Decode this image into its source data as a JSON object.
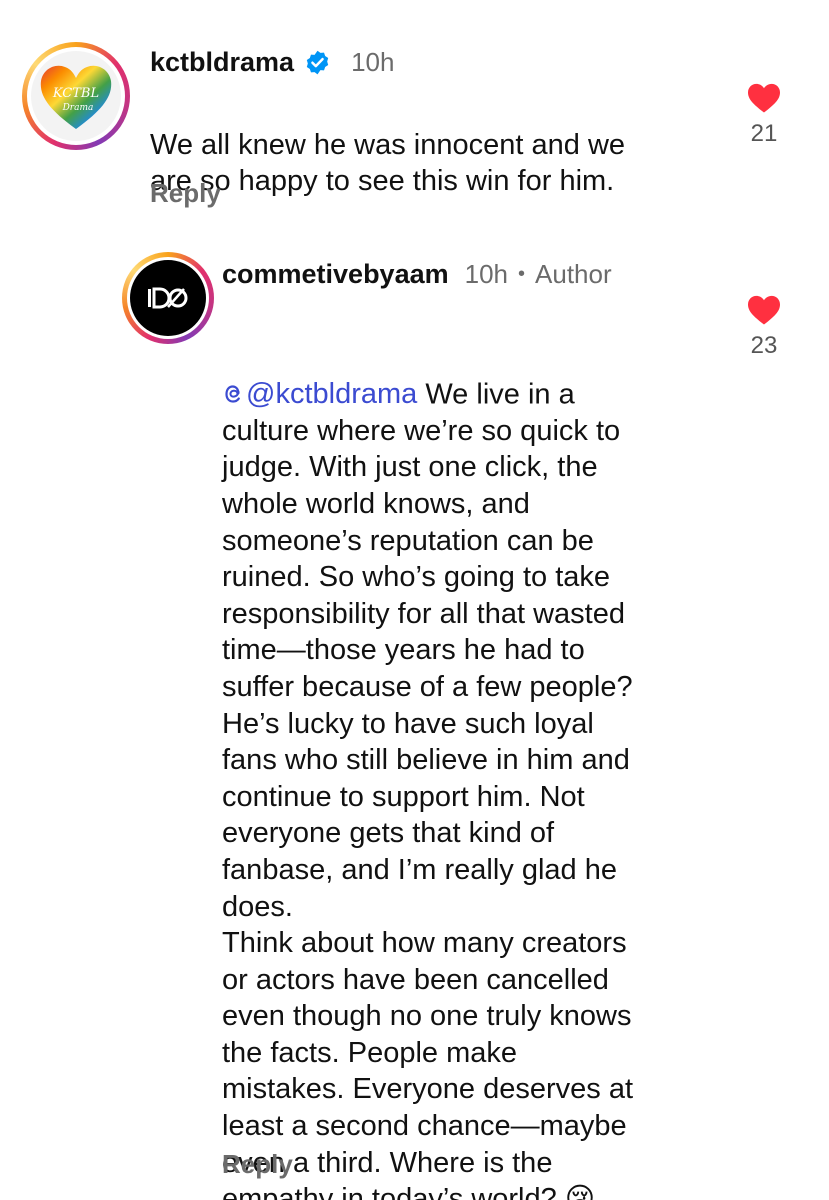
{
  "comments": [
    {
      "username": "kctbldrama",
      "verified": true,
      "time": "10h",
      "author_tag": "",
      "mention": "",
      "text": "We all knew he was innocent and we\nare so happy to see this win for him.",
      "reply_label": "Reply",
      "likes": "21",
      "avatar_text": "KCTBL",
      "avatar_subtext": "Drama"
    },
    {
      "username": "commetivebyaam",
      "verified": false,
      "time": "10h",
      "separator": "•",
      "author_tag": "Author",
      "mention": "@kctbldrama",
      "text": " We live in a\nculture where we’re so quick to\njudge. With just one click, the\nwhole world knows, and\nsomeone’s reputation can be\nruined. So who’s going to take\nresponsibility for all that wasted\ntime—those years he had to\nsuffer because of a few people?\nHe’s lucky to have such loyal\nfans who still believe in him and\ncontinue to support him. Not\neveryone gets that kind of\nfanbase, and I’m really glad he\ndoes.\nThink about how many creators\nor actors have been cancelled\neven though no one truly knows\nthe facts. People make\nmistakes. Everyone deserves at\nleast a second chance—maybe\neven a third. Where is the\nempathy in today’s world? 😢",
      "reply_label": "Reply",
      "likes": "23"
    }
  ],
  "colors": {
    "heart": "#ff3040",
    "mention": "#3b4bd1",
    "verified": "#0095f6",
    "meta": "#6b6b6b"
  },
  "icons": {
    "verified": "verified-badge-icon",
    "like": "heart-icon",
    "threads": "threads-icon"
  }
}
